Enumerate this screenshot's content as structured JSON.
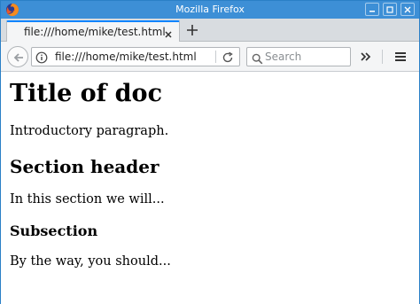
{
  "window": {
    "title": "Mozilla Firefox"
  },
  "tab": {
    "title": "file:///home/mike/test.html"
  },
  "navbar": {
    "url": "file:///home/mike/test.html",
    "search_placeholder": "Search"
  },
  "document": {
    "h1": "Title of doc",
    "intro": "Introductory paragraph.",
    "h2": "Section header",
    "section_text": "In this section we will...",
    "h3": "Subsection",
    "subsection_text": "By the way, you should..."
  },
  "colors": {
    "titlebar": "#3d8fd6",
    "tab_accent": "#0a84ff",
    "toolbar": "#f4f5f6"
  },
  "icons": [
    "firefox-icon",
    "minimize-icon",
    "maximize-icon",
    "close-icon",
    "tab-close-icon",
    "new-tab-icon",
    "back-arrow-icon",
    "info-icon",
    "reload-icon",
    "search-icon",
    "overflow-chevron-icon",
    "hamburger-menu-icon"
  ]
}
